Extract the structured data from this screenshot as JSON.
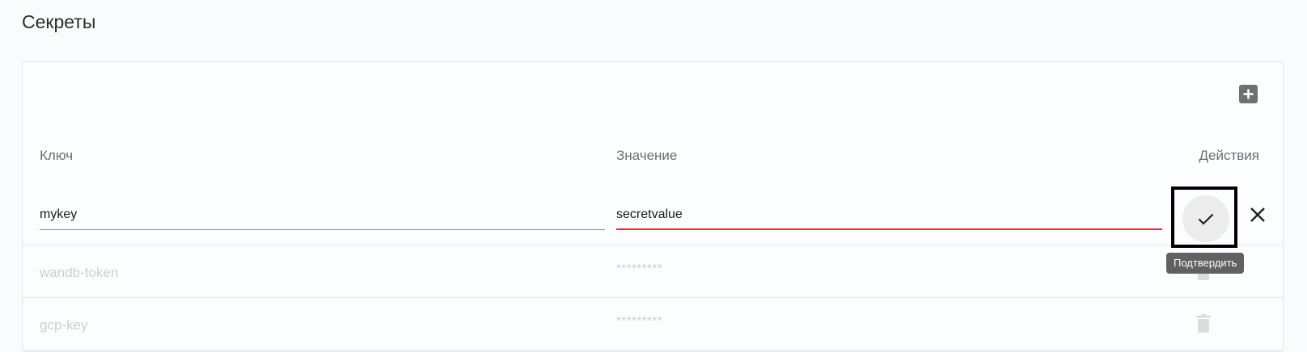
{
  "page": {
    "title": "Секреты"
  },
  "toolbar": {
    "add_icon": "plus-square-icon"
  },
  "table": {
    "headers": {
      "key": "Ключ",
      "value": "Значение",
      "actions": "Действия"
    },
    "edit_row": {
      "key_value": "mykey",
      "value_value": "secretvalue",
      "confirm_icon": "check-icon",
      "cancel_icon": "close-icon",
      "confirm_tooltip": "Подтвердить"
    },
    "rows": [
      {
        "key": "wandb-token",
        "value": "*********",
        "action_icon": "trash-icon"
      },
      {
        "key": "gcp-key",
        "value": "*********",
        "action_icon": "trash-icon"
      }
    ]
  },
  "colors": {
    "error_underline": "#d32f2f",
    "tooltip_bg": "#616161",
    "add_button_bg": "#707070"
  }
}
